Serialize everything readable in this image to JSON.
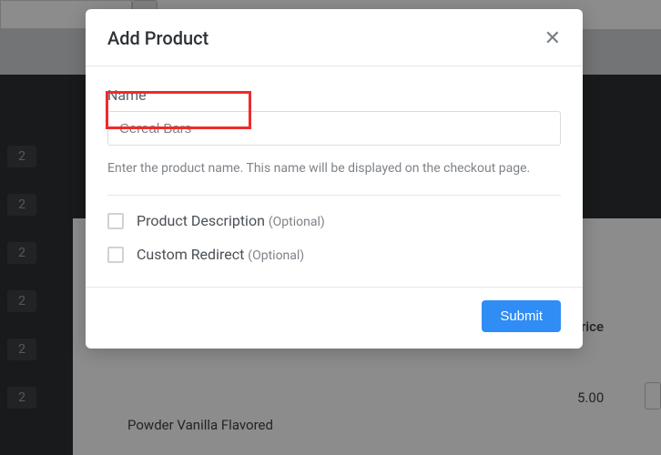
{
  "modal": {
    "title": "Add Product",
    "name_label": "Name",
    "name_value": "Cereal Bars",
    "name_help": "Enter the product name. This name will be displayed on the checkout page.",
    "option_description": "Product Description",
    "option_redirect": "Custom Redirect",
    "optional_tag": "(Optional)",
    "submit_label": "Submit"
  },
  "background": {
    "sidebar_pills": [
      "2",
      "2",
      "2",
      "2",
      "2",
      "2"
    ],
    "product_line": "Powder Vanilla Flavored",
    "price_header": "rice",
    "price_value": "5.00"
  }
}
